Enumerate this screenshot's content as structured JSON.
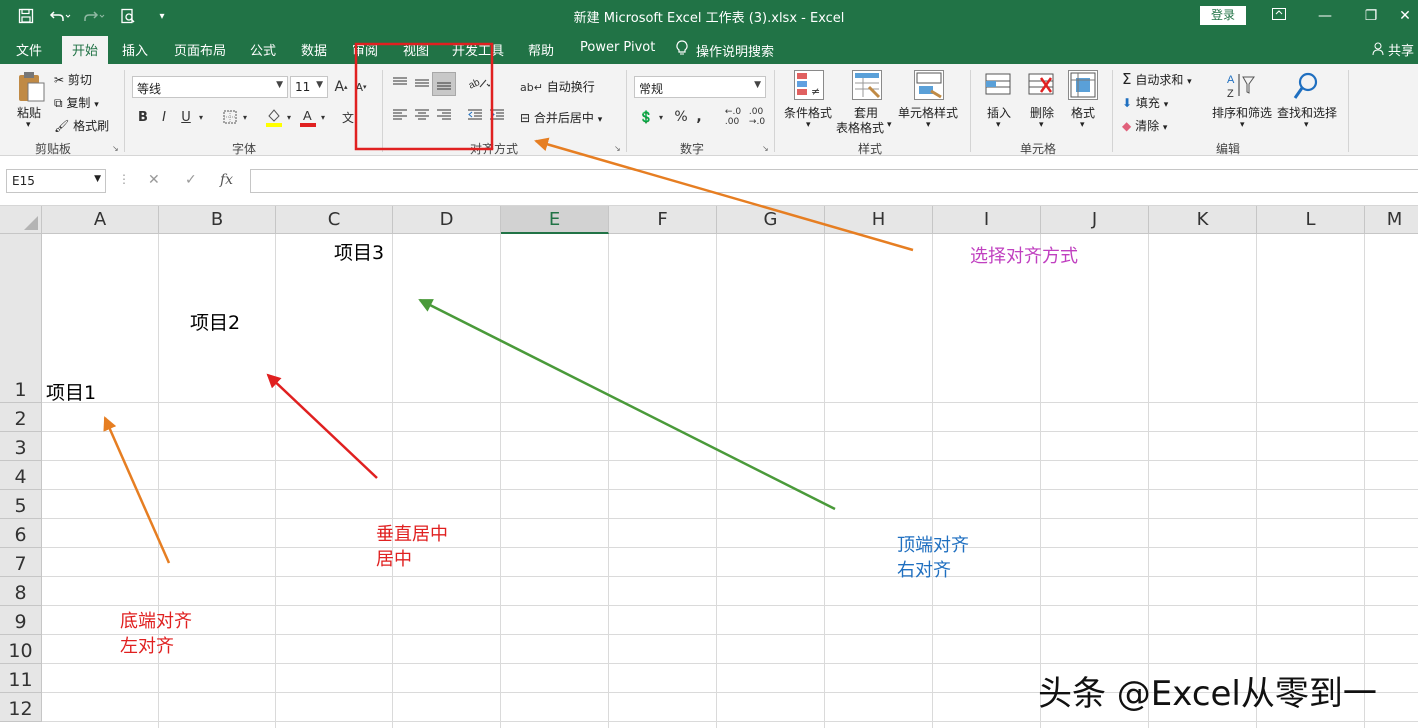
{
  "titlebar": {
    "title": "新建 Microsoft Excel 工作表 (3).xlsx  -  Excel",
    "login": "登录",
    "bg_color": "#217346"
  },
  "tabs": {
    "file": "文件",
    "home": "开始",
    "insert": "插入",
    "layout": "页面布局",
    "formulas": "公式",
    "data": "数据",
    "review": "审阅",
    "view": "视图",
    "developer": "开发工具",
    "help": "帮助",
    "powerpivot": "Power Pivot",
    "tellme": "操作说明搜索",
    "share": "共享"
  },
  "ribbon": {
    "clipboard": {
      "paste": "粘贴",
      "cut": "剪切",
      "copy": "复制",
      "format_painter": "格式刷",
      "label": "剪贴板"
    },
    "font": {
      "name": "等线",
      "size": "11",
      "label": "字体"
    },
    "alignment": {
      "wrap": "自动换行",
      "merge": "合并后居中",
      "label": "对齐方式"
    },
    "number": {
      "format": "常规",
      "label": "数字"
    },
    "styles": {
      "conditional": "条件格式",
      "table_line1": "套用",
      "table_line2": "表格格式",
      "cell_styles": "单元格样式",
      "label": "样式"
    },
    "cells": {
      "insert": "插入",
      "delete": "删除",
      "format": "格式",
      "label": "单元格"
    },
    "editing": {
      "autosum": "自动求和",
      "fill": "填充",
      "clear": "清除",
      "sort": "排序和筛选",
      "find": "查找和选择",
      "label": "编辑"
    }
  },
  "formula_bar": {
    "name_box": "E15",
    "fx": "fx",
    "value": ""
  },
  "grid": {
    "columns": [
      "A",
      "B",
      "C",
      "D",
      "E",
      "F",
      "G",
      "H",
      "I",
      "J",
      "K",
      "L",
      "M"
    ],
    "selected_column": "E",
    "rows": [
      "1",
      "2",
      "3",
      "4",
      "5",
      "6",
      "7",
      "8",
      "9",
      "10",
      "11",
      "12"
    ]
  },
  "cells": {
    "a1": "项目1",
    "b1": "项目2",
    "c1": "项目3"
  },
  "annotations": {
    "choose_alignment": "选择对齐方式",
    "a_line1": "底端对齐",
    "a_line2": "左对齐",
    "b_line1": "垂直居中",
    "b_line2": "居中",
    "c_line1": "顶端对齐",
    "c_line2": "右对齐",
    "purple": "#c040c0",
    "red": "#e02020",
    "blue": "#1f6fc0",
    "orange": "#e67e22",
    "green": "#4a9a3a"
  },
  "watermark": "头条 @Excel从零到一"
}
